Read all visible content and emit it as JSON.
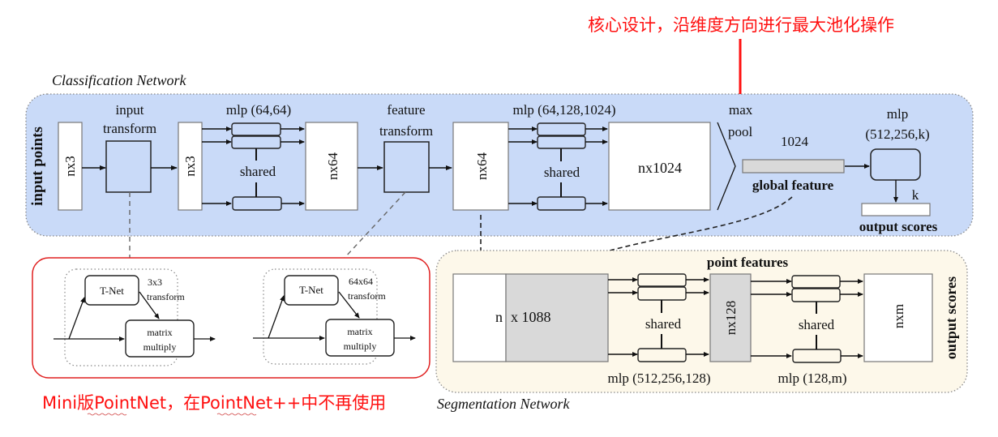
{
  "annotations": {
    "top_note": "核心设计，沿维度方向进行最大池化操作",
    "bottom_note": "Mini版PointNet，在PointNet++中不再使用",
    "colors": {
      "annotation": "#ff1010",
      "classification_bg": "#c9daf8",
      "segmentation_bg": "#fdf8ea",
      "feature_gray": "#d9d9d9",
      "mini_box_border": "#e02020"
    }
  },
  "classification": {
    "title": "Classification Network",
    "input_points_label": "input points",
    "input_block": "nx3",
    "input_transform_label": [
      "input",
      "transform"
    ],
    "transformed_input_block": "nx3",
    "mlp1_label": "mlp (64,64)",
    "shared_label": "shared",
    "features_block": "nx64",
    "feature_transform_label": [
      "feature",
      "transform"
    ],
    "transformed_features_block": "nx64",
    "mlp2_label": "mlp (64,128,1024)",
    "shared_label_2": "shared",
    "big_block": "nx1024",
    "max_pool_label": [
      "max",
      "pool"
    ],
    "global_feature_size": "1024",
    "global_feature_label": "global feature",
    "mlp3_label": [
      "mlp",
      "(512,256,k)"
    ],
    "k_label": "k",
    "output_label": "output scores"
  },
  "mini_pointnets": [
    {
      "tnet_label": "T-Net",
      "transform_label": [
        "3x3",
        "transform"
      ],
      "matmul_label": [
        "matrix",
        "multiply"
      ]
    },
    {
      "tnet_label": "T-Net",
      "transform_label": [
        "64x64",
        "transform"
      ],
      "matmul_label": [
        "matrix",
        "multiply"
      ]
    }
  ],
  "segmentation": {
    "title": "Segmentation Network",
    "point_features_label": "point features",
    "concat_left": "n",
    "concat_right": "x 1088",
    "shared_label": "shared",
    "mlp1_label": "mlp (512,256,128)",
    "mid_block": "nx128",
    "shared_label_2": "shared",
    "mlp2_label": "mlp (128,m)",
    "out_block": "nxm",
    "output_label": "output scores"
  }
}
